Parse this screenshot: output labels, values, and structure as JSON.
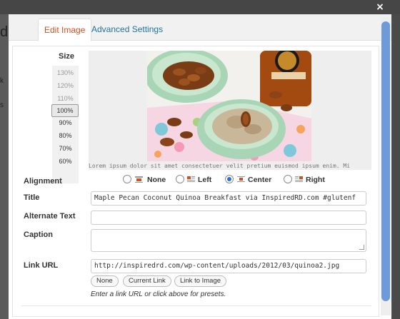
{
  "backdrop": {
    "chars": [
      "d",
      "k",
      "s"
    ]
  },
  "window": {
    "close_label": "×"
  },
  "tabs": [
    {
      "label": "Edit Image",
      "active": true
    },
    {
      "label": "Advanced Settings",
      "active": false
    }
  ],
  "size": {
    "title": "Size",
    "options": [
      "130%",
      "120%",
      "110%",
      "100%",
      "90%",
      "80%",
      "70%",
      "60%"
    ],
    "selected": "100%"
  },
  "preview": {
    "lorem": "Lorem ipsum dolor sit amet consectetuer velit pretium euismod ipsum enim. Mi"
  },
  "form": {
    "alignment": {
      "label": "Alignment",
      "options": [
        "None",
        "Left",
        "Center",
        "Right"
      ],
      "selected": "Center"
    },
    "title": {
      "label": "Title",
      "value": "Maple Pecan Coconut Quinoa Breakfast via InspiredRD.com #glutenf"
    },
    "alt_text": {
      "label": "Alternate Text",
      "value": ""
    },
    "caption": {
      "label": "Caption",
      "value": ""
    },
    "link_url": {
      "label": "Link URL",
      "value": "http://inspiredrd.com/wp-content/uploads/2012/03/quinoa2.jpg",
      "buttons": [
        "None",
        "Current Link",
        "Link to Image"
      ],
      "hint": "Enter a link URL or click above for presets."
    }
  },
  "colors": {
    "accent": "#d54e21",
    "link": "#21759b",
    "scroll": "#6e9bd8"
  }
}
